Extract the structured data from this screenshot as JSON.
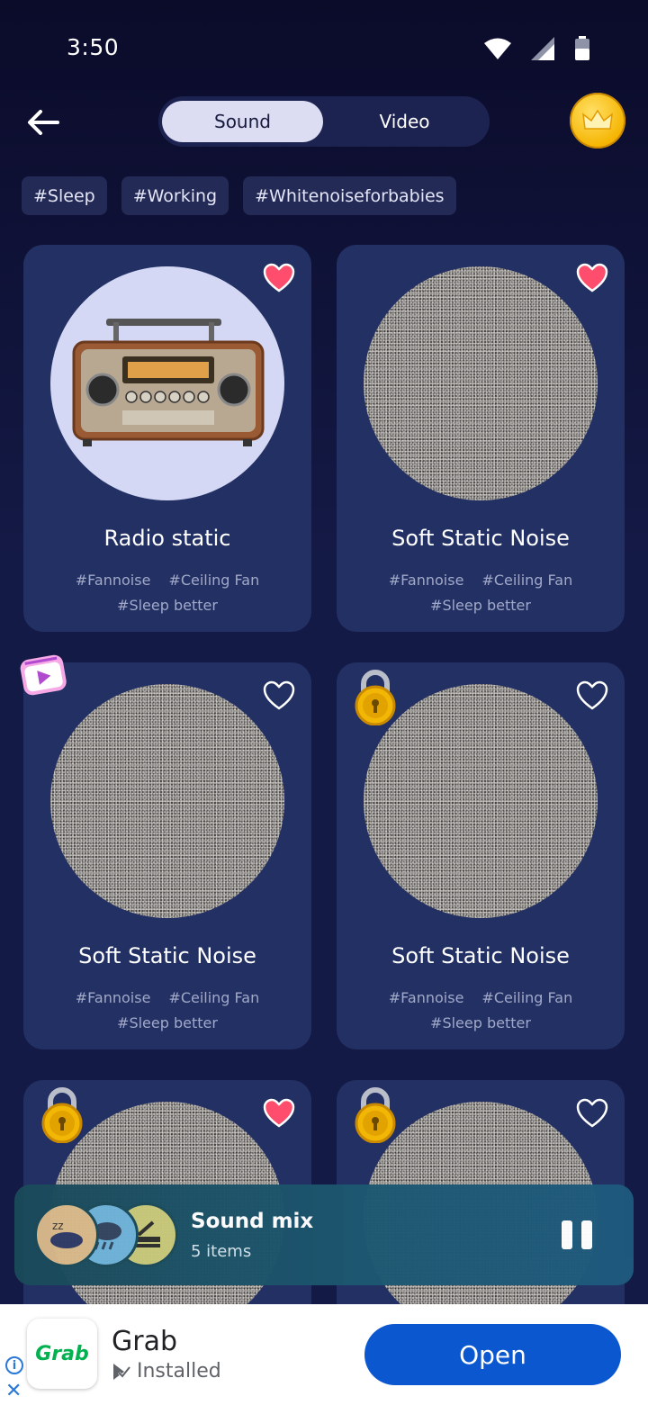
{
  "status_bar": {
    "time": "3:50"
  },
  "tabs": {
    "sound": "Sound",
    "video": "Video"
  },
  "filter_tags": [
    "#Sleep",
    "#Working",
    "#Whitenoiseforbabies"
  ],
  "cards": [
    {
      "title": "Radio static",
      "tags": [
        "#Fannoise",
        "#Ceiling Fan",
        "#Sleep better"
      ],
      "favorite": true,
      "art": "radio",
      "badge": "none"
    },
    {
      "title": "Soft Static Noise",
      "tags": [
        "#Fannoise",
        "#Ceiling Fan",
        "#Sleep better"
      ],
      "favorite": true,
      "art": "noise",
      "badge": "none"
    },
    {
      "title": "Soft Static Noise",
      "tags": [
        "#Fannoise",
        "#Ceiling Fan",
        "#Sleep better"
      ],
      "favorite": false,
      "art": "noise",
      "badge": "video"
    },
    {
      "title": "Soft Static Noise",
      "tags": [
        "#Fannoise",
        "#Ceiling Fan",
        "#Sleep better"
      ],
      "favorite": false,
      "art": "noise",
      "badge": "lock"
    },
    {
      "title": "",
      "tags": [],
      "favorite": true,
      "art": "noise",
      "badge": "lock"
    },
    {
      "title": "",
      "tags": [],
      "favorite": false,
      "art": "noise",
      "badge": "lock"
    }
  ],
  "sound_mix": {
    "title": "Sound mix",
    "subtitle": "5 items"
  },
  "ad": {
    "app_name": "Grab",
    "logo_text": "Grab",
    "status": "Installed",
    "cta": "Open"
  },
  "colors": {
    "background": "#141a46",
    "card": "#223063",
    "heart": "#ff4d6d",
    "accent_gold": "#f5b400",
    "ad_button": "#0b57d0"
  }
}
